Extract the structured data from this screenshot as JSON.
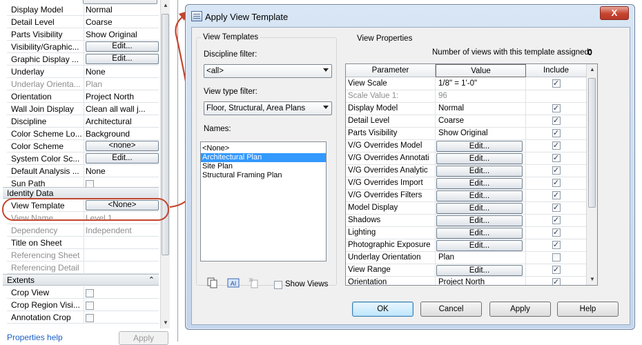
{
  "properties": {
    "rows": [
      {
        "name": "Display Model",
        "value": "Normal",
        "type": "text"
      },
      {
        "name": "Detail Level",
        "value": "Coarse",
        "type": "text"
      },
      {
        "name": "Parts Visibility",
        "value": "Show Original",
        "type": "text"
      },
      {
        "name": "Visibility/Graphic...",
        "value": "Edit...",
        "type": "button"
      },
      {
        "name": "Graphic Display ...",
        "value": "Edit...",
        "type": "button"
      },
      {
        "name": "Underlay",
        "value": "None",
        "type": "text"
      },
      {
        "name": "Underlay Orienta...",
        "value": "Plan",
        "type": "text",
        "gray": true
      },
      {
        "name": "Orientation",
        "value": "Project North",
        "type": "text"
      },
      {
        "name": "Wall Join Display",
        "value": "Clean all wall j...",
        "type": "text"
      },
      {
        "name": "Discipline",
        "value": "Architectural",
        "type": "text"
      },
      {
        "name": "Color Scheme Lo...",
        "value": "Background",
        "type": "text"
      },
      {
        "name": "Color Scheme",
        "value": "<none>",
        "type": "button"
      },
      {
        "name": "System Color Sc...",
        "value": "Edit...",
        "type": "button"
      },
      {
        "name": "Default Analysis ...",
        "value": "None",
        "type": "text"
      },
      {
        "name": "Sun Path",
        "value": "",
        "type": "check",
        "checked": false
      }
    ],
    "identity_section": "Identity Data",
    "identity_rows": [
      {
        "name": "View Template",
        "value": "<None>",
        "type": "button"
      },
      {
        "name": "View Name",
        "value": "Level 1",
        "type": "text",
        "gray": true
      },
      {
        "name": "Dependency",
        "value": "Independent",
        "type": "text",
        "gray": true
      },
      {
        "name": "Title on Sheet",
        "value": "",
        "type": "text"
      },
      {
        "name": "Referencing Sheet",
        "value": "",
        "type": "text",
        "gray": true
      },
      {
        "name": "Referencing Detail",
        "value": "",
        "type": "text",
        "gray": true
      }
    ],
    "extents_section": "Extents",
    "extents_rows": [
      {
        "name": "Crop View",
        "value": "",
        "type": "check",
        "checked": false
      },
      {
        "name": "Crop Region Visi...",
        "value": "",
        "type": "check",
        "checked": false
      },
      {
        "name": "Annotation Crop",
        "value": "",
        "type": "check",
        "checked": false
      }
    ],
    "help_link": "Properties help",
    "apply_label": "Apply"
  },
  "dialog": {
    "title": "Apply View Template",
    "close_label": "X",
    "view_templates": {
      "group_label": "View Templates",
      "discipline_label": "Discipline filter:",
      "discipline_value": "<all>",
      "type_label": "View type filter:",
      "type_value": "Floor, Structural, Area Plans",
      "names_label": "Names:",
      "names": [
        "<None>",
        "Architectural Plan",
        "Site Plan",
        "Structural Framing Plan"
      ],
      "selected_name": "Architectural Plan",
      "show_views_label": "Show Views"
    },
    "view_properties": {
      "group_label": "View Properties",
      "count_label": "Number of views with this template assigned:",
      "count_value": "0",
      "columns": [
        "Parameter",
        "Value",
        "Include"
      ],
      "rows": [
        {
          "param": "View Scale",
          "value": "1/8\" = 1'-0\"",
          "type": "combo",
          "include": true
        },
        {
          "param": "Scale Value    1:",
          "value": "96",
          "type": "text",
          "include": null,
          "gray": true
        },
        {
          "param": "Display Model",
          "value": "Normal",
          "type": "text",
          "include": true
        },
        {
          "param": "Detail Level",
          "value": "Coarse",
          "type": "text",
          "include": true
        },
        {
          "param": "Parts Visibility",
          "value": "Show Original",
          "type": "text",
          "include": true
        },
        {
          "param": "V/G Overrides Model",
          "value": "Edit...",
          "type": "button",
          "include": true
        },
        {
          "param": "V/G Overrides Annotati",
          "value": "Edit...",
          "type": "button",
          "include": true
        },
        {
          "param": "V/G Overrides Analytic",
          "value": "Edit...",
          "type": "button",
          "include": true
        },
        {
          "param": "V/G Overrides Import",
          "value": "Edit...",
          "type": "button",
          "include": true
        },
        {
          "param": "V/G Overrides Filters",
          "value": "Edit...",
          "type": "button",
          "include": true
        },
        {
          "param": "Model Display",
          "value": "Edit...",
          "type": "button",
          "include": true
        },
        {
          "param": "Shadows",
          "value": "Edit...",
          "type": "button",
          "include": true
        },
        {
          "param": "Lighting",
          "value": "Edit...",
          "type": "button",
          "include": true
        },
        {
          "param": "Photographic Exposure",
          "value": "Edit...",
          "type": "button",
          "include": true
        },
        {
          "param": "Underlay Orientation",
          "value": "Plan",
          "type": "text",
          "include": false
        },
        {
          "param": "View Range",
          "value": "Edit...",
          "type": "button",
          "include": true
        },
        {
          "param": "Orientation",
          "value": "Project North",
          "type": "text",
          "include": true
        }
      ]
    },
    "buttons": {
      "ok": "OK",
      "cancel": "Cancel",
      "apply": "Apply",
      "help": "Help"
    }
  },
  "colors": {
    "annotation": "#c2452d",
    "selection": "#3399ff",
    "link": "#1a5ec7"
  }
}
